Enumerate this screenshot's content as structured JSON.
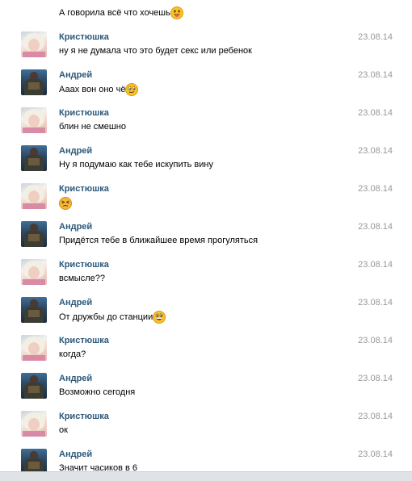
{
  "top_message": {
    "text": "А говорила всё что хочешь",
    "emoji": "tongue-out-emoji"
  },
  "messages": [
    {
      "author": "Кристюшка",
      "date": "23.08.14",
      "text": "ну я не думала что это будет секс или ребенок",
      "avatar": "girl"
    },
    {
      "author": "Андрей",
      "date": "23.08.14",
      "text": "Аааx вон оно чё",
      "avatar": "guy",
      "emoji": "wink-emoji"
    },
    {
      "author": "Кристюшка",
      "date": "23.08.14",
      "text": "блин не смешно",
      "avatar": "girl"
    },
    {
      "author": "Андрей",
      "date": "23.08.14",
      "text": "Ну я подумаю как тебе искупить вину",
      "avatar": "guy"
    },
    {
      "author": "Кристюшка",
      "date": "23.08.14",
      "text": "",
      "avatar": "girl",
      "emoji": "squint-emoji"
    },
    {
      "author": "Андрей",
      "date": "23.08.14",
      "text": "Придётся тебе в ближайшее время прогуляться",
      "avatar": "guy"
    },
    {
      "author": "Кристюшка",
      "date": "23.08.14",
      "text": "всмысле??",
      "avatar": "girl"
    },
    {
      "author": "Андрей",
      "date": "23.08.14",
      "text": "От дружбы до станции",
      "avatar": "guy",
      "emoji": "laugh-emoji"
    },
    {
      "author": "Кристюшка",
      "date": "23.08.14",
      "text": "когда?",
      "avatar": "girl"
    },
    {
      "author": "Андрей",
      "date": "23.08.14",
      "text": "Возможно сегодня",
      "avatar": "guy"
    },
    {
      "author": "Кристюшка",
      "date": "23.08.14",
      "text": "ок",
      "avatar": "girl"
    },
    {
      "author": "Андрей",
      "date": "23.08.14",
      "text": "Значит часиков в 6",
      "avatar": "guy"
    }
  ],
  "colors": {
    "author_name": "#2b587a",
    "date": "#999999",
    "emoji_face": "#f7c325",
    "emoji_outline": "#d99a12"
  }
}
